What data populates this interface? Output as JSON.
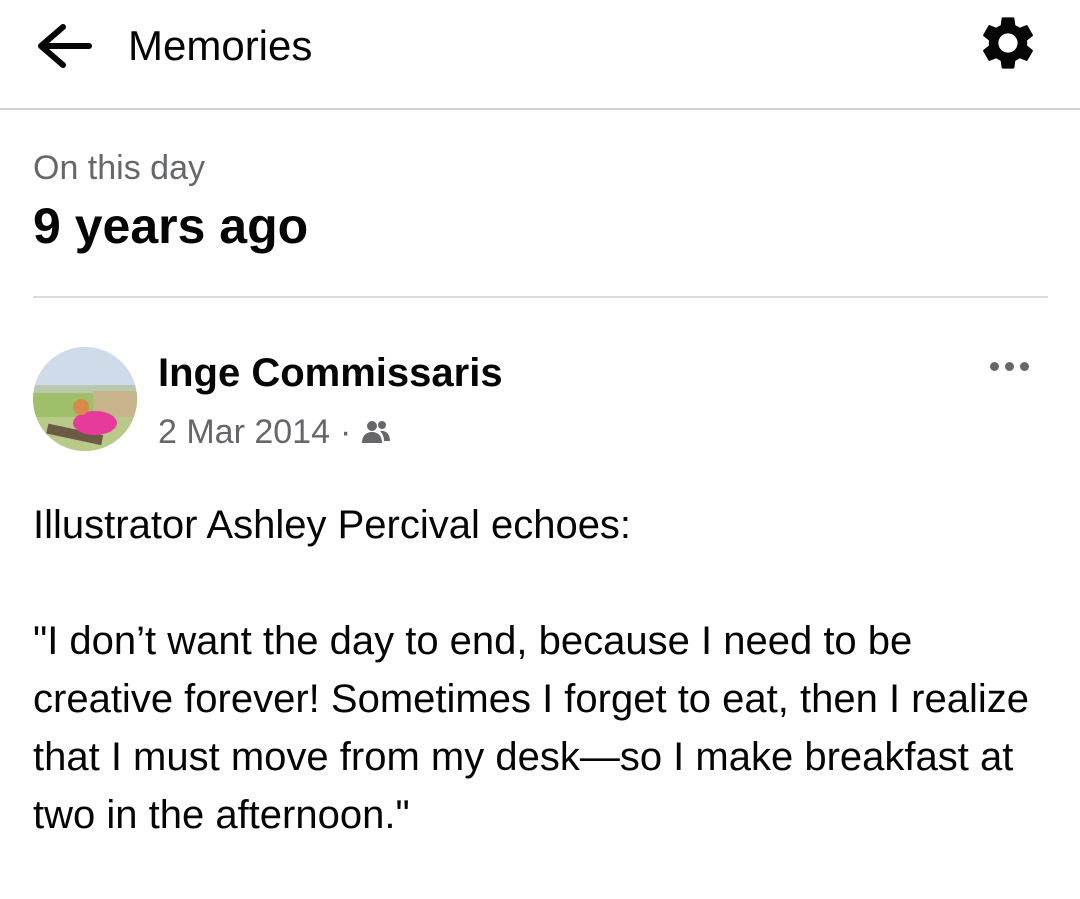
{
  "header": {
    "title": "Memories",
    "back_icon": "arrow-left-icon",
    "settings_icon": "gear-icon"
  },
  "section": {
    "label": "On this day",
    "heading": "9 years ago"
  },
  "post": {
    "author": "Inge Commissaris",
    "date": "2 Mar 2014",
    "separator": "·",
    "audience_icon": "friends-icon",
    "more_icon": "more-options-icon",
    "intro": "Illustrator Ashley Percival echoes:",
    "quote": "\"I don’t want the day to end, because I need to be creative forever! Sometimes I forget to eat, then I realize that I must move from my desk—so I make breakfast at two in the afternoon.\""
  },
  "colors": {
    "text_primary": "#050505",
    "text_secondary": "#65676b",
    "divider": "#dcdcdc"
  }
}
